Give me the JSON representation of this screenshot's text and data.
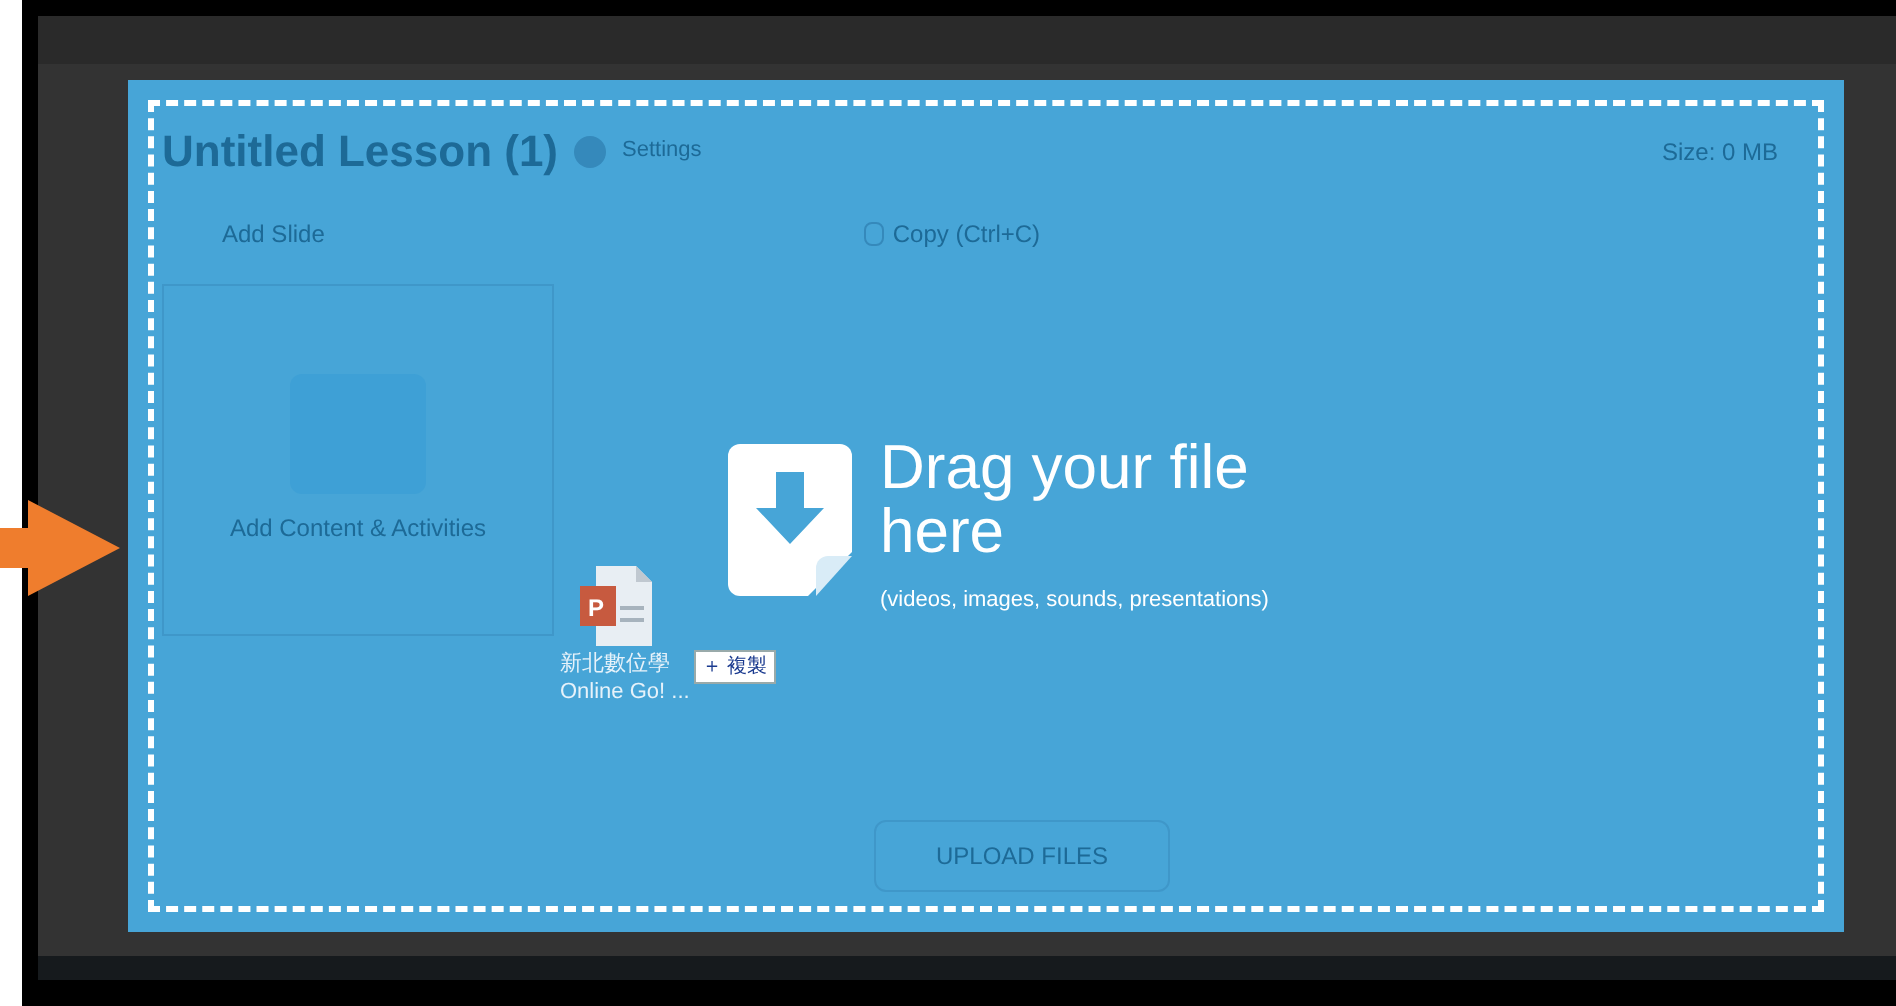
{
  "background": {
    "lesson_title": "Untitled Lesson (1)",
    "settings_link": "Settings",
    "size": "Size: 0 MB",
    "add_slide": "Add Slide",
    "copy": "Copy (Ctrl+C)",
    "add_content": "Add Content & Activities",
    "upload_button": "UPLOAD FILES"
  },
  "drop_zone": {
    "title": "Drag your file here",
    "hint": "(videos, images, sounds, presentations)"
  },
  "dragged_file": {
    "icon_letter": "P",
    "name_line_1": "新北數位學",
    "name_line_2": "Online Go! ...",
    "badge_symbol": "＋",
    "badge_label": "複製"
  }
}
